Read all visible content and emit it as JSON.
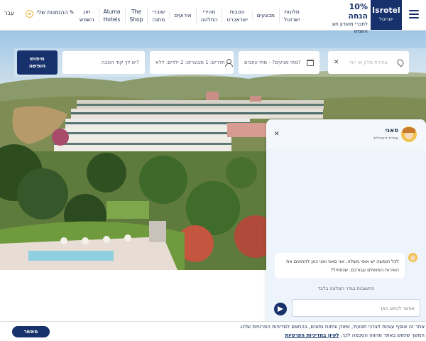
{
  "header": {
    "menu_icon": "hamburger-icon",
    "logo": {
      "main": "Isrotel",
      "sub": "ישרוטל"
    },
    "promo": {
      "title": "10% הנחה",
      "line1": "לחברי מועדון חוג",
      "line2": "השמש"
    },
    "nav": [
      {
        "line1": "מלונות",
        "line2": "ישרוטל"
      },
      {
        "line1": "מבצעים",
        "line2": ""
      },
      {
        "line1": "הטבות",
        "line2": "ישראכרט"
      },
      {
        "line1": "מהירי",
        "line2": "החלטה"
      },
      {
        "line1": "אירועים",
        "line2": ""
      },
      {
        "line1": "שוברי",
        "line2": "מתנה"
      },
      {
        "line1": "The",
        "line2": "Shop"
      },
      {
        "line1": "Aluma",
        "line2": "Hotels"
      },
      {
        "line1": "חוג",
        "line2": "השמש"
      }
    ],
    "my_bookings": "ההזמנות שלי",
    "language": "עבר"
  },
  "search": {
    "destination_placeholder": "בחירת מלון או יעד",
    "dates": "מתי מגיעים?  -  מתי עוזבים?",
    "guests": "חדרים: 1 מבוגרים: 2 ילדים: ללא",
    "promo_code": "יש לך קוד הטבה?",
    "button_line1": "חיפוש",
    "button_line2": "חופשה"
  },
  "chat": {
    "agent_name": "סאני",
    "agent_role": "עוזרת דיגיטלית",
    "message": "לכל חופשה יש אופי משלה. אני סאני ואני כאן להתאים את האירוח המושלם עבורכם. שנתחיל?",
    "disclaimer": "התשובות בגדר המלצה בלבד",
    "input_placeholder": "אפשר לכתוב כאן"
  },
  "cookie": {
    "line1": "אתר זה אוסף עוגיות לצרכי תפעול, שיווק וניתוח נתונים, בהתאם למדיניות הפרטיות שלנו.",
    "line2": "המשך שימוש באתר מהווה הסכמה לכך.",
    "link": "לעיון במדיניות הפרטיות",
    "button": "מאשר"
  },
  "colors": {
    "brand": "#16316b",
    "accent": "#e7b93c"
  }
}
